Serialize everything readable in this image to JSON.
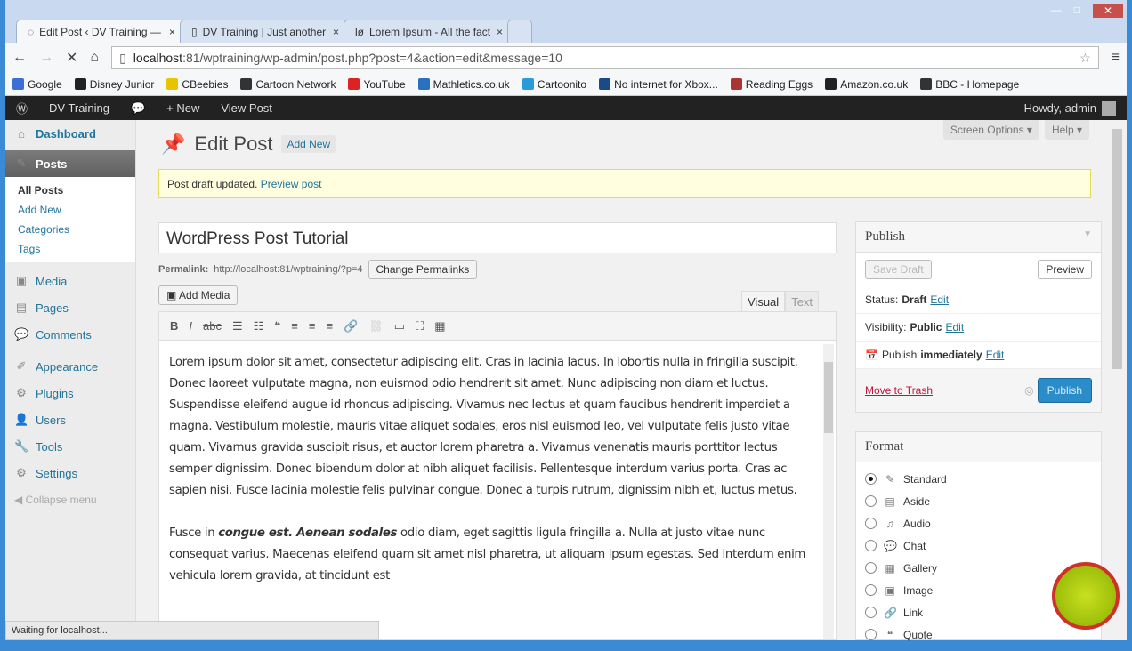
{
  "browser": {
    "tabs": [
      {
        "title": "Edit Post ‹ DV Training —"
      },
      {
        "title": "DV Training | Just another"
      },
      {
        "title": "Lorem Ipsum - All the fact"
      }
    ],
    "url_host": "localhost",
    "url_rest": ":81/wptraining/wp-admin/post.php?post=4&action=edit&message=10",
    "bookmarks": [
      {
        "label": "Google",
        "color": "#3a6fd8"
      },
      {
        "label": "Disney Junior",
        "color": "#222"
      },
      {
        "label": "CBeebies",
        "color": "#e8c400"
      },
      {
        "label": "Cartoon Network",
        "color": "#333"
      },
      {
        "label": "YouTube",
        "color": "#d22"
      },
      {
        "label": "Mathletics.co.uk",
        "color": "#2a6fc0"
      },
      {
        "label": "Cartoonito",
        "color": "#2a9ad8"
      },
      {
        "label": "No internet for Xbox...",
        "color": "#1a4a8a"
      },
      {
        "label": "Reading Eggs",
        "color": "#a33"
      },
      {
        "label": "Amazon.co.uk",
        "color": "#222"
      },
      {
        "label": "BBC - Homepage",
        "color": "#333"
      }
    ],
    "status": "Waiting for localhost..."
  },
  "adminbar": {
    "site": "DV Training",
    "new": "+ New",
    "view": "View Post",
    "howdy": "Howdy, admin"
  },
  "sidebar": {
    "items": [
      {
        "label": "Dashboard",
        "icon": "dashboard-icon"
      },
      {
        "label": "Posts",
        "icon": "pin-icon"
      },
      {
        "label": "Media",
        "icon": "media-icon"
      },
      {
        "label": "Pages",
        "icon": "pages-icon"
      },
      {
        "label": "Comments",
        "icon": "comments-icon"
      },
      {
        "label": "Appearance",
        "icon": "appearance-icon"
      },
      {
        "label": "Plugins",
        "icon": "plugins-icon"
      },
      {
        "label": "Users",
        "icon": "users-icon"
      },
      {
        "label": "Tools",
        "icon": "tools-icon"
      },
      {
        "label": "Settings",
        "icon": "settings-icon"
      }
    ],
    "sub": [
      "All Posts",
      "Add New",
      "Categories",
      "Tags"
    ],
    "collapse": "Collapse menu"
  },
  "header": {
    "title": "Edit Post",
    "add_new": "Add New",
    "screen_options": "Screen Options ▾",
    "help": "Help ▾"
  },
  "notice": {
    "text": "Post draft updated.",
    "link": "Preview post"
  },
  "post": {
    "title": "WordPress Post Tutorial",
    "permalink_label": "Permalink:",
    "permalink": "http://localhost:81/wptraining/?p=4",
    "change_permalinks": "Change Permalinks",
    "add_media": "Add Media",
    "tab_visual": "Visual",
    "tab_text": "Text",
    "p1": "Lorem ipsum dolor sit amet, consectetur adipiscing elit. Cras in lacinia lacus. In lobortis nulla in fringilla suscipit. Donec laoreet vulputate magna, non euismod odio hendrerit sit amet. Nunc adipiscing non diam et luctus. Suspendisse eleifend augue id rhoncus adipiscing. Vivamus nec lectus et quam faucibus hendrerit imperdiet a magna. Vestibulum molestie, mauris vitae aliquet sodales, eros nisl euismod leo, vel vulputate felis justo vitae quam. Vivamus gravida suscipit risus, et auctor lorem pharetra a. Vivamus venenatis mauris porttitor lectus semper dignissim. Donec bibendum dolor at nibh aliquet facilisis. Pellentesque interdum varius porta. Cras ac sapien nisi. Fusce lacinia molestie felis pulvinar congue. Donec a turpis rutrum, dignissim nibh et, luctus metus.",
    "p2_a": "Fusce in ",
    "p2_bold": "congue est. Aenean sodales",
    "p2_b": " odio diam, eget sagittis ligula fringilla a. Nulla at justo vitae nunc consequat varius. Maecenas eleifend quam sit amet nisl pharetra, ut aliquam ipsum egestas. Sed interdum enim vehicula lorem gravida, at tincidunt est"
  },
  "publish": {
    "title": "Publish",
    "save_draft": "Save Draft",
    "preview": "Preview",
    "status_label": "Status:",
    "status": "Draft",
    "visibility_label": "Visibility:",
    "visibility": "Public",
    "publish_label": "Publish",
    "publish_when": "immediately",
    "edit": "Edit",
    "trash": "Move to Trash",
    "publish_btn": "Publish"
  },
  "format": {
    "title": "Format",
    "options": [
      {
        "label": "Standard",
        "icon": "✎"
      },
      {
        "label": "Aside",
        "icon": "▤"
      },
      {
        "label": "Audio",
        "icon": "♫"
      },
      {
        "label": "Chat",
        "icon": "💬"
      },
      {
        "label": "Gallery",
        "icon": "▦"
      },
      {
        "label": "Image",
        "icon": "▣"
      },
      {
        "label": "Link",
        "icon": "🔗"
      },
      {
        "label": "Quote",
        "icon": "❝"
      }
    ],
    "selected": "Standard"
  }
}
